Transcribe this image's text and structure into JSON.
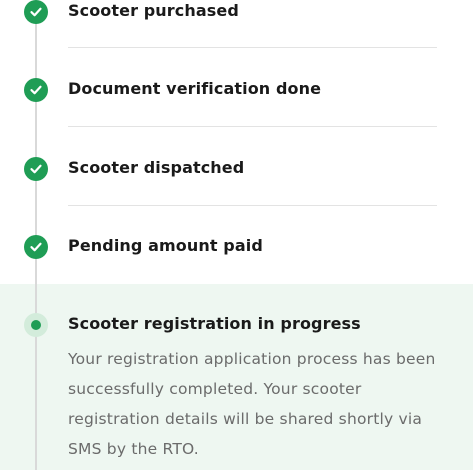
{
  "steps": [
    {
      "label": "Scooter purchased",
      "status": "done",
      "icon": "check-icon"
    },
    {
      "label": "Document verification done",
      "status": "done",
      "icon": "check-icon"
    },
    {
      "label": "Scooter dispatched",
      "status": "done",
      "icon": "check-icon"
    },
    {
      "label": "Pending amount paid",
      "status": "done",
      "icon": "check-icon"
    },
    {
      "label": "Scooter registration in progress",
      "status": "in-progress",
      "icon": "progress-dot-icon",
      "description": "Your registration application process has been successfully completed. Your scooter registration details will be shared shortly via SMS by the RTO."
    }
  ],
  "colors": {
    "success": "#1f9d55",
    "current_bg": "#eef7f1",
    "rail": "#d9d9d9"
  }
}
